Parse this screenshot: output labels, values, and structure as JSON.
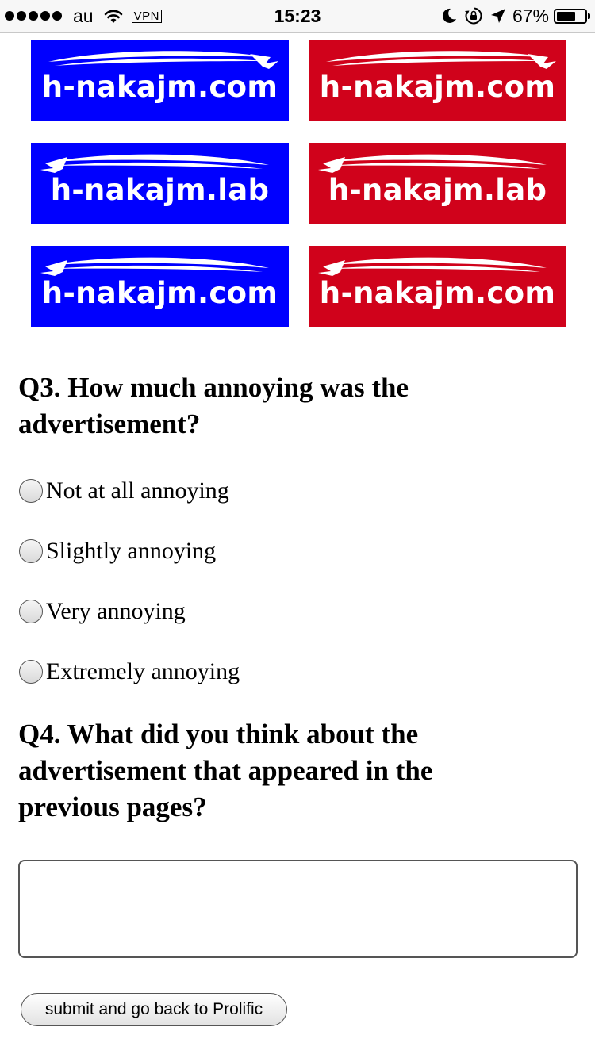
{
  "status_bar": {
    "carrier": "au",
    "vpn": "VPN",
    "time": "15:23",
    "battery_percent": "67%",
    "battery_level": 0.67,
    "icons": [
      "signal-dots-icon",
      "wifi-icon",
      "moon-icon",
      "rotation-lock-icon",
      "location-arrow-icon",
      "battery-icon"
    ]
  },
  "banners": [
    {
      "text": "h-nakajm.com",
      "color": "#0000ff",
      "swoosh": "right"
    },
    {
      "text": "h-nakajm.com",
      "color": "#d0021b",
      "swoosh": "right"
    },
    {
      "text": "h-nakajm.lab",
      "color": "#0000ff",
      "swoosh": "left"
    },
    {
      "text": "h-nakajm.lab",
      "color": "#d0021b",
      "swoosh": "left"
    },
    {
      "text": "h-nakajm.com",
      "color": "#0000ff",
      "swoosh": "left"
    },
    {
      "text": "h-nakajm.com",
      "color": "#d0021b",
      "swoosh": "left"
    }
  ],
  "q3": {
    "line1": "Q3. How much annoying was the",
    "line2": "advertisement?",
    "options": [
      {
        "label": "Not at all annoying"
      },
      {
        "label": "Slightly annoying"
      },
      {
        "label": "Very annoying"
      },
      {
        "label": "Extremely annoying"
      }
    ]
  },
  "q4": {
    "line1": "Q4. What did you think about the",
    "line2": "advertisement that appeared in the",
    "line3": "previous pages?",
    "answer_value": ""
  },
  "submit": {
    "label": "submit and go back to Prolific"
  }
}
